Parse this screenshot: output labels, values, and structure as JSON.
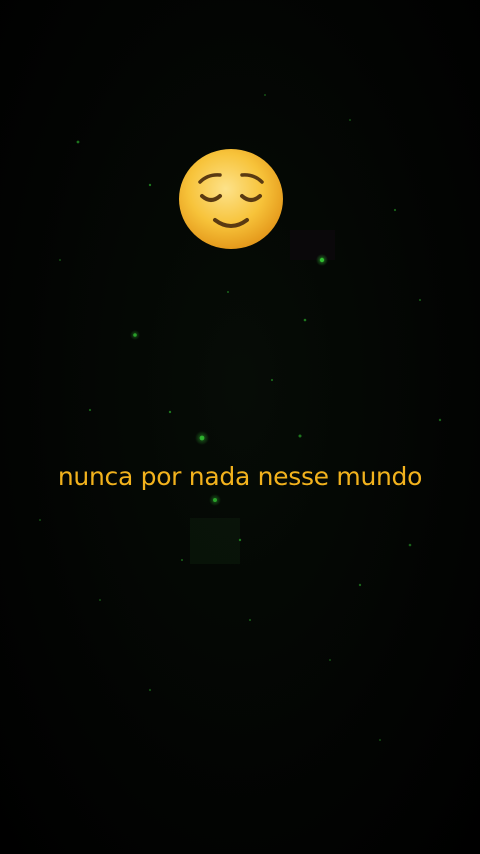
{
  "video": {
    "caption": "nunca por nada nesse mundo",
    "emoji_icon": "relieved-face-emoji-icon"
  },
  "colors": {
    "caption_text": "#f2b21d",
    "background": "#000000",
    "particle_green": "#1fae1f",
    "emoji_face": "#f7c33a",
    "emoji_features": "#5a3a12"
  }
}
